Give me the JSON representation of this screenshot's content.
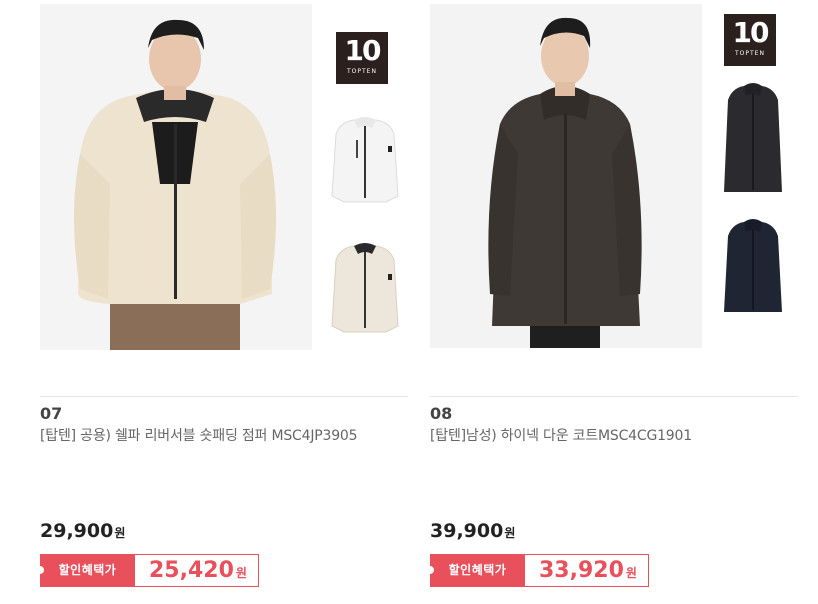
{
  "products": [
    {
      "rank": "07",
      "title": "[탑텐] 공용) 쉘파 리버서블 숏패딩 점퍼 MSC4JP3905",
      "price": "29,900",
      "currency": "원",
      "discount_label": "할인혜택가",
      "discount_price": "25,420",
      "badge": {
        "number": "10",
        "text": "TOPTEN"
      },
      "colors": {
        "main": "#efe6d6",
        "thumb1": "#f2f2f2",
        "thumb2": "#ebe5da",
        "accent": "#e8505b"
      }
    },
    {
      "rank": "08",
      "title": "[탑텐]남성) 하이넥 다운 코트MSC4CG1901",
      "price": "39,900",
      "currency": "원",
      "discount_label": "할인혜택가",
      "discount_price": "33,920",
      "badge": {
        "number": "10",
        "text": "TOPTEN"
      },
      "colors": {
        "main": "#3f3936",
        "thumb1": "#2b2b2f",
        "thumb2": "#1f2533",
        "accent": "#e8505b"
      }
    }
  ]
}
